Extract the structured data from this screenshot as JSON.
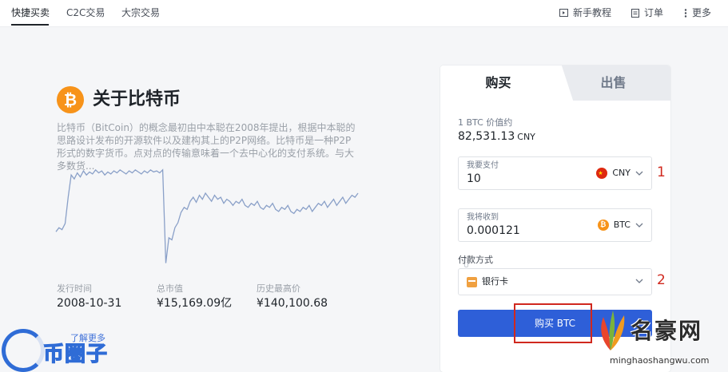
{
  "topnav": {
    "tabs": [
      {
        "label": "快捷买卖"
      },
      {
        "label": "C2C交易"
      },
      {
        "label": "大宗交易"
      }
    ],
    "right": [
      {
        "label": "新手教程",
        "icon": "video-icon"
      },
      {
        "label": "订单",
        "icon": "document-icon"
      },
      {
        "label": "更多",
        "icon": "more-icon"
      }
    ]
  },
  "about": {
    "coin_symbol": "₿",
    "title": "关于比特币",
    "description": "比特币（BitCoin）的概念最初由中本聪在2008年提出，根据中本聪的思路设计发布的开源软件以及建构其上的P2P网络。比特币是一种P2P形式的数字货币。点对点的传输意味着一个去中心化的支付系统。与大多数货...",
    "stats": [
      {
        "label": "发行时间",
        "value": "2008-10-31"
      },
      {
        "label": "总市值",
        "value": "¥15,169.09亿"
      },
      {
        "label": "历史最高价",
        "value": "¥140,100.68"
      }
    ],
    "learn_more": "了解更多"
  },
  "trade": {
    "tabs": {
      "buy": "购买",
      "sell": "出售"
    },
    "price_label": "1 BTC 价值约",
    "price_value": "82,531.13",
    "price_unit": "CNY",
    "pay": {
      "label": "我要支付",
      "value": "10",
      "currency": "CNY"
    },
    "receive": {
      "label": "我将收到",
      "value": "0.000121",
      "currency": "BTC"
    },
    "payment_method_label": "付款方式",
    "payment_method": "银行卡",
    "buy_button": "购买 BTC"
  },
  "annotations": {
    "one": "1",
    "two": "2"
  },
  "watermarks": {
    "left_text": "币圈子",
    "right_name": "名豪网",
    "right_site": "minghaoshangwu.com"
  },
  "colors": {
    "accent": "#2e5fd8",
    "bitcoin": "#f7931a",
    "annotation_red": "#d0281e"
  },
  "chart_data": {
    "type": "line",
    "title": "",
    "xlabel": "",
    "ylabel": "",
    "x": [
      0,
      1,
      2,
      3,
      4,
      5,
      6,
      7,
      8,
      9,
      10,
      11,
      12,
      13,
      14,
      15,
      16,
      17,
      18,
      19,
      20,
      21,
      22,
      23,
      24,
      25,
      26,
      27,
      28,
      29,
      30,
      31,
      32,
      33,
      34,
      35,
      36,
      37,
      38,
      39,
      40,
      41,
      42,
      43,
      44,
      45,
      46,
      47,
      48,
      49,
      50,
      51,
      52,
      53,
      54,
      55,
      56,
      57,
      58,
      59,
      60,
      61,
      62,
      63,
      64,
      65,
      66,
      67,
      68,
      69,
      70,
      71,
      72,
      73,
      74,
      75,
      76,
      77,
      78,
      79,
      80,
      81,
      82,
      83,
      84,
      85,
      86,
      87,
      88,
      89,
      90,
      91,
      92,
      93,
      94,
      95,
      96,
      97,
      98,
      99
    ],
    "values": [
      36,
      40,
      38,
      44,
      70,
      92,
      88,
      94,
      90,
      96,
      92,
      95,
      93,
      97,
      94,
      96,
      92,
      95,
      93,
      96,
      94,
      97,
      95,
      93,
      96,
      94,
      97,
      95,
      93,
      96,
      94,
      97,
      95,
      96,
      94,
      97,
      5,
      30,
      28,
      40,
      45,
      55,
      60,
      58,
      66,
      70,
      65,
      72,
      68,
      74,
      70,
      66,
      72,
      68,
      70,
      64,
      68,
      66,
      62,
      66,
      64,
      68,
      62,
      60,
      64,
      62,
      66,
      60,
      58,
      62,
      60,
      64,
      58,
      56,
      60,
      58,
      62,
      56,
      54,
      58,
      56,
      60,
      58,
      62,
      56,
      60,
      64,
      62,
      66,
      60,
      64,
      68,
      62,
      66,
      70,
      64,
      68,
      72,
      70,
      74
    ],
    "ylim": [
      0,
      100
    ]
  }
}
